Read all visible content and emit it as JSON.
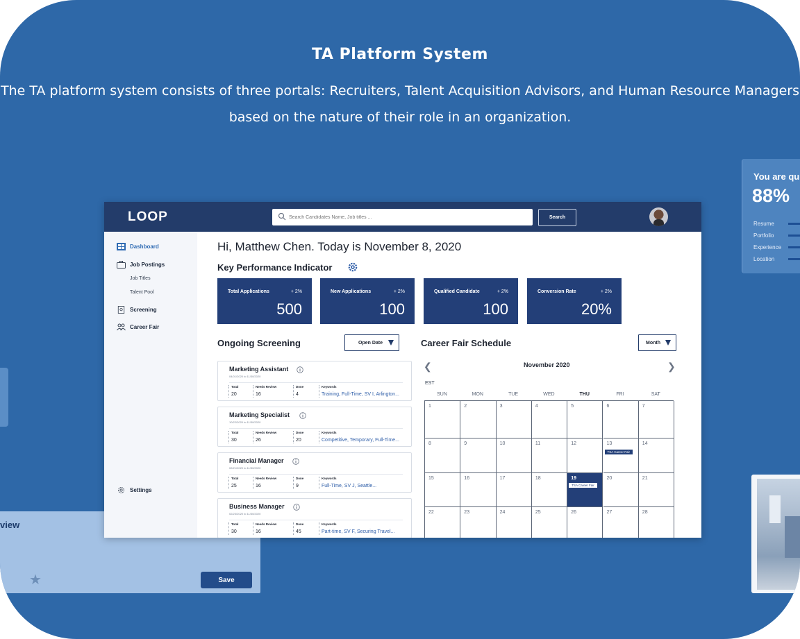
{
  "hero": {
    "title": "TA Platform System",
    "line1": "The TA platform system consists of three portals: Recruiters, Talent Acquisition Advisors, and Human Resource Managers",
    "line2": "based on the nature of their role in an organization."
  },
  "side_card": {
    "title": "You are qu",
    "percent": "88%",
    "rows": [
      "Resume",
      "Portfolio",
      "Experience",
      "Location"
    ]
  },
  "bottom_card": {
    "text": "view",
    "save_label": "Save"
  },
  "app": {
    "logo": "LOOP",
    "search": {
      "placeholder": "Search Candidates Name, Job titles ...",
      "button": "Search"
    },
    "sidebar": {
      "items": [
        {
          "label": "Dashboard",
          "icon": "dashboard-icon"
        },
        {
          "label": "Job Postings",
          "icon": "briefcase-icon"
        },
        {
          "label": "Job Titles"
        },
        {
          "label": "Talent Pool"
        },
        {
          "label": "Screening",
          "icon": "screening-icon"
        },
        {
          "label": "Career Fair",
          "icon": "people-icon"
        }
      ],
      "settings": "Settings"
    },
    "greeting": "Hi, Matthew Chen. Today is November 8, 2020",
    "kpi_title": "Key Performance Indicator",
    "kpis": [
      {
        "label": "Total Applications",
        "delta": "+ 2%",
        "value": "500"
      },
      {
        "label": "New Applications",
        "delta": "+ 2%",
        "value": "100"
      },
      {
        "label": "Qualified Candidate",
        "delta": "+ 2%",
        "value": "100"
      },
      {
        "label": "Conversion Rate",
        "delta": "+ 2%",
        "value": "20%"
      }
    ],
    "screening": {
      "title": "Ongoing Screening",
      "dropdown": "Open Date",
      "headers": {
        "total": "Total",
        "needs_review": "Needs Review",
        "done": "Done",
        "keywords": "Keywords"
      },
      "cards": [
        {
          "name": "Marketing Assistant",
          "date": "04/01/2020 to 11/30/2020",
          "total": "20",
          "needs_review": "16",
          "done": "4",
          "keywords": "Training, Full-Time, SV I, Arlington..."
        },
        {
          "name": "Marketing Specialist",
          "date": "10/22/2020 to 11/30/2020",
          "total": "30",
          "needs_review": "26",
          "done": "20",
          "keywords": "Competitive, Temporary, Full-Time..."
        },
        {
          "name": "Financial Manager",
          "date": "02/21/2020 to 11/30/2020",
          "total": "25",
          "needs_review": "16",
          "done": "9",
          "keywords": "Full-Time, SV J, Seattle..."
        },
        {
          "name": "Business Manager",
          "date": "02/23/2020 to 11/30/2020",
          "total": "30",
          "needs_review": "16",
          "done": "45",
          "keywords": "Part-time, SV F, Securing Travel..."
        }
      ]
    },
    "calendar": {
      "title": "Career Fair Schedule",
      "dropdown": "Month",
      "month": "November 2020",
      "timezone": "EST",
      "days": [
        "SUN",
        "MON",
        "TUE",
        "WED",
        "THU",
        "FRI",
        "SAT"
      ],
      "weeks": [
        [
          "1",
          "2",
          "3",
          "4",
          "5",
          "6",
          "7"
        ],
        [
          "8",
          "9",
          "10",
          "11",
          "12",
          "13",
          "14"
        ],
        [
          "15",
          "16",
          "17",
          "18",
          "19",
          "20",
          "21"
        ],
        [
          "22",
          "23",
          "24",
          "25",
          "26",
          "27",
          "28"
        ]
      ],
      "events": [
        {
          "day": "13",
          "label": "TSA Career Fair"
        },
        {
          "day": "19",
          "label": "TSA Career Fair"
        }
      ]
    }
  },
  "colors": {
    "background": "#2e68a8",
    "navy": "#233c6a",
    "kpi": "#233f78",
    "accent": "#2f6bb3"
  }
}
